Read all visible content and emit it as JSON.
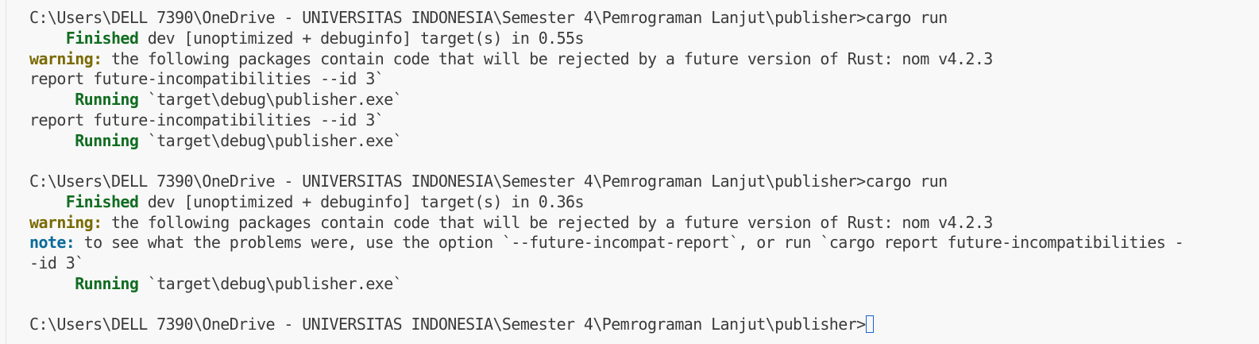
{
  "terminal": {
    "prompt": "C:\\Users\\DELL 7390\\OneDrive - UNIVERSITAS INDONESIA\\Semester 4\\Pemrograman Lanjut\\publisher>",
    "command": "cargo run",
    "runs": [
      {
        "finished_label": "Finished",
        "finished_text": " dev [unoptimized + debuginfo] target(s) in 0.55s",
        "warning_label": "warning:",
        "warning_text": " the following packages contain code that will be rejected by a future version of Rust: nom v4.2.3",
        "report_line_1": "report future-incompatibilities --id 3`",
        "running_label_1": "Running",
        "running_text_1": " `target\\debug\\publisher.exe`",
        "report_line_2": "report future-incompatibilities --id 3`",
        "running_label_2": "Running",
        "running_text_2": " `target\\debug\\publisher.exe`"
      },
      {
        "finished_label": "Finished",
        "finished_text": " dev [unoptimized + debuginfo] target(s) in 0.36s",
        "warning_label": "warning:",
        "warning_text": " the following packages contain code that will be rejected by a future version of Rust: nom v4.2.3",
        "note_label": "note:",
        "note_text": " to see what the problems were, use the option `--future-incompat-report`, or run `cargo report future-incompatibilities -",
        "note_continuation": "-id 3`",
        "running_label": "Running",
        "running_text": " `target\\debug\\publisher.exe`"
      }
    ],
    "colors": {
      "background": "#f8f8f8",
      "text": "#3b3b3b",
      "finished": "#116d21",
      "warning": "#7a6a00",
      "note": "#0a6b9a",
      "cursor": "#1a5fd1"
    }
  }
}
